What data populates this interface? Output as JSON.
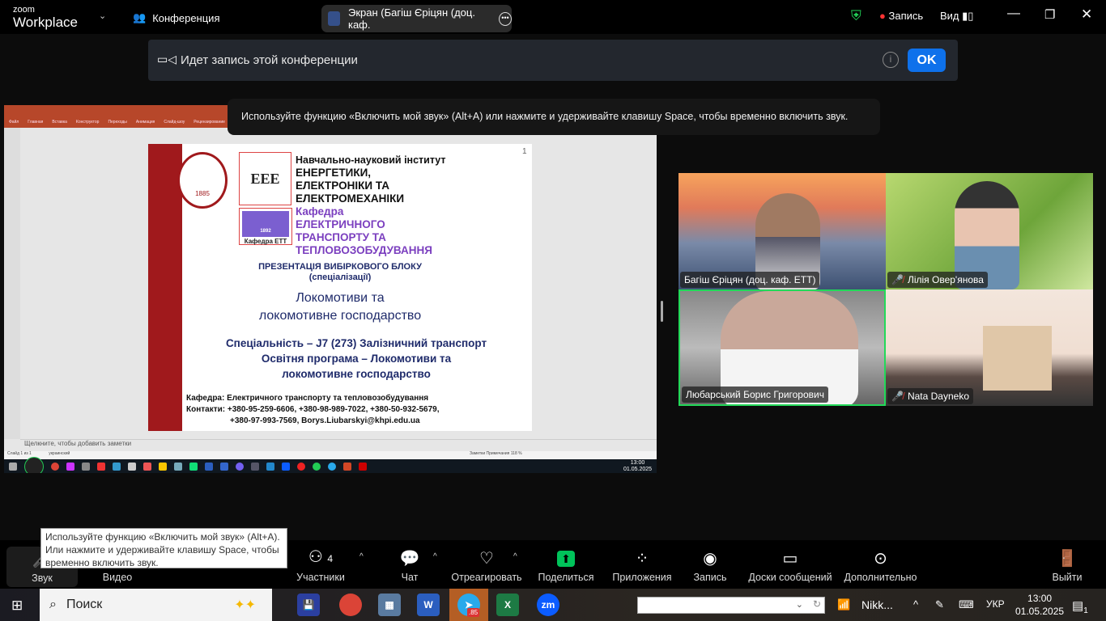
{
  "topbar": {
    "logo_small": "zoom",
    "logo_big": "Workplace",
    "meeting": "Конференция",
    "share_title": "Экран (Багіш Єріцян (доц. каф.",
    "record": "Запись",
    "view": "Вид"
  },
  "banner": {
    "text": "Идет запись этой конференции",
    "ok": "OK"
  },
  "hint": "Используйте функцию «Включить мой звук» (Alt+A) или нажмите и удерживайте клавишу Space, чтобы временно включить звук.",
  "ppt": {
    "tabs": [
      "Файл",
      "Главная",
      "Вставка",
      "Конструктор",
      "Переходы",
      "Анимация",
      "Слайд-шоу",
      "Рецензирование"
    ],
    "notes": "Щелкните, чтобы добавить заметки",
    "status_left": "Слайд 1 из 1",
    "lang": "украинский",
    "status_right": "Заметки   Примечания   118 %",
    "clock": "13:00",
    "date": "01.05.2025"
  },
  "slide": {
    "number": "1",
    "seal_year": "1885",
    "eee": "EEE",
    "ett_year": "1892",
    "ett_label": "Кафедра ЕТТ",
    "inst_lines": [
      "Навчально-науковий інститут",
      "ЕНЕРГЕТИКИ,",
      "ЕЛЕКТРОНІКИ ТА",
      "ЕЛЕКТРОМЕХАНІКИ"
    ],
    "dept_lines": [
      "Кафедра",
      "ЕЛЕКТРИЧНОГО",
      "ТРАНСПОРТУ ТА",
      "ТЕПЛОВОЗОБУДУВАННЯ"
    ],
    "presentation": "ПРЕЗЕНТАЦІЯ ВИБІРКОВОГО БЛОКУ",
    "spec": "(спеціалізації)",
    "title1": "Локомотиви та",
    "title2": "локомотивне господарство",
    "s1": "Спеціальність – J7 (273) Залізничний транспорт",
    "s2": "Освітня програма – Локомотиви та",
    "s3": "локомотивне господарство",
    "c1": "Кафедра:  Електричного транспорту та тепловозобудування",
    "c2": "Контакти: +380-95-259-6606, +380-98-989-7022, +380-50-932-5679,",
    "c3": "+380-97-993-7569, Borys.Liubarskyi@khpi.edu.ua"
  },
  "participants": [
    {
      "name": "Багіш Єріцян (доц. каф. ЕТТ)",
      "muted": false
    },
    {
      "name": "Лілія Овер'янова",
      "muted": true
    },
    {
      "name": "Любарський Борис Григорович",
      "muted": false,
      "active": true
    },
    {
      "name": "Nata Dayneko",
      "muted": true
    }
  ],
  "toolbar": {
    "audio": "Звук",
    "video": "Видео",
    "participants": "Участники",
    "participants_count": "4",
    "chat": "Чат",
    "react": "Отреагировать",
    "share": "Поделиться",
    "apps": "Приложения",
    "record": "Запись",
    "boards": "Доски сообщений",
    "more": "Дополнительно",
    "leave": "Выйти",
    "accent": "#0e71eb",
    "share_color": "#00c35a"
  },
  "tooltip": "Используйте функцию «Включить мой звук» (Alt+A). Или нажмите и удерживайте клавишу Space, чтобы временно включить звук.",
  "taskbar": {
    "search": "Поиск",
    "telegram_badge": ".85",
    "app_nikk": "Nikk...",
    "lang": "УКР",
    "time": "13:00",
    "date": "01.05.2025",
    "notif": "1"
  }
}
